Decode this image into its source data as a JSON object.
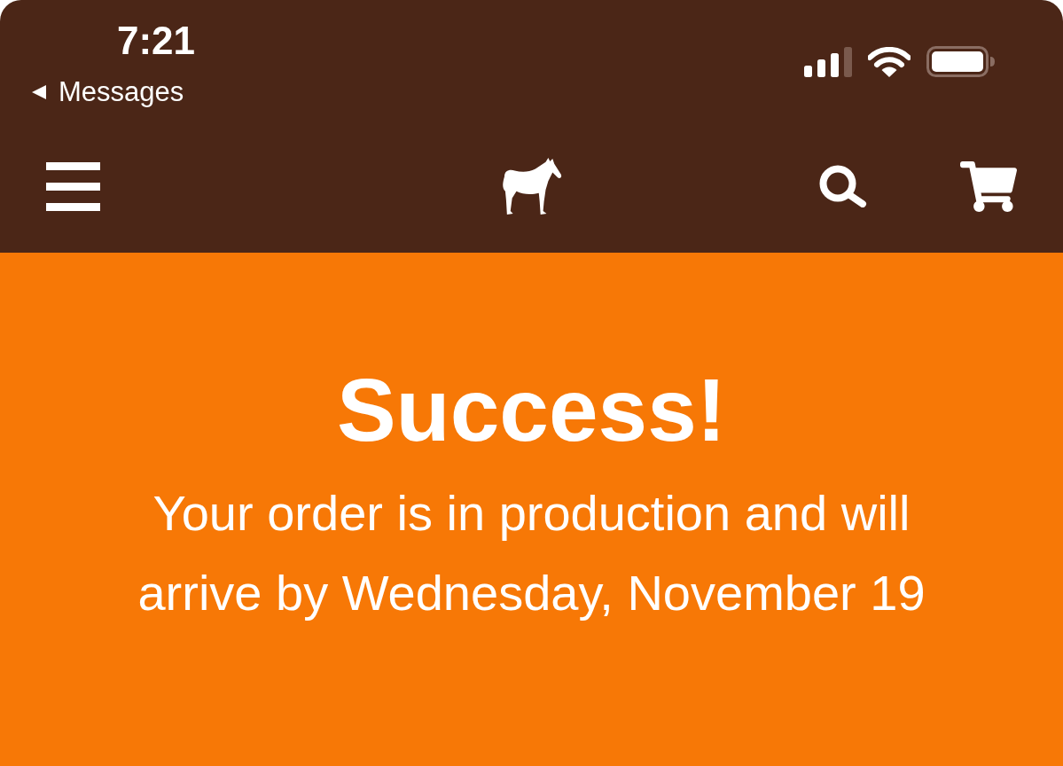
{
  "status_bar": {
    "time": "7:21",
    "back_link": "Messages"
  },
  "confirmation": {
    "title": "Success!",
    "message": "Your order is in production and will arrive by Wednesday, November 19"
  }
}
